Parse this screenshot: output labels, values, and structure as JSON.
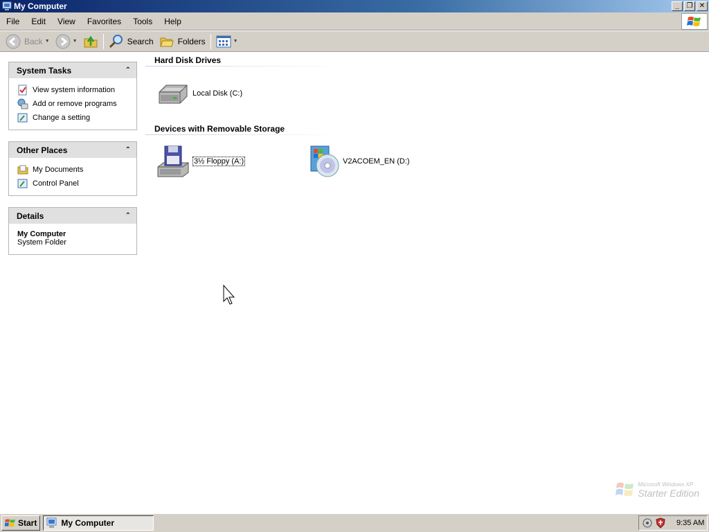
{
  "window": {
    "title": "My Computer",
    "minimize": "_",
    "restore": "❐",
    "close": "✕"
  },
  "menu": [
    "File",
    "Edit",
    "View",
    "Favorites",
    "Tools",
    "Help"
  ],
  "toolbar": {
    "back": "Back",
    "search": "Search",
    "folders": "Folders"
  },
  "panels": {
    "system_tasks": {
      "title": "System Tasks",
      "items": [
        "View system information",
        "Add or remove programs",
        "Change a setting"
      ]
    },
    "other_places": {
      "title": "Other Places",
      "items": [
        "My Documents",
        "Control Panel"
      ]
    },
    "details": {
      "title": "Details",
      "name": "My Computer",
      "type": "System Folder"
    }
  },
  "content": {
    "hard_disks": {
      "heading": "Hard Disk Drives",
      "items": [
        "Local Disk (C:)"
      ]
    },
    "removable": {
      "heading": "Devices with Removable Storage",
      "items": [
        "3½ Floppy (A:)",
        "V2ACOEM_EN (D:)"
      ]
    }
  },
  "watermark": {
    "line1": "Microsoft Windows XP",
    "line2": "Starter Edition"
  },
  "taskbar": {
    "start": "Start",
    "active_task": "My Computer",
    "clock": "9:35 AM"
  }
}
